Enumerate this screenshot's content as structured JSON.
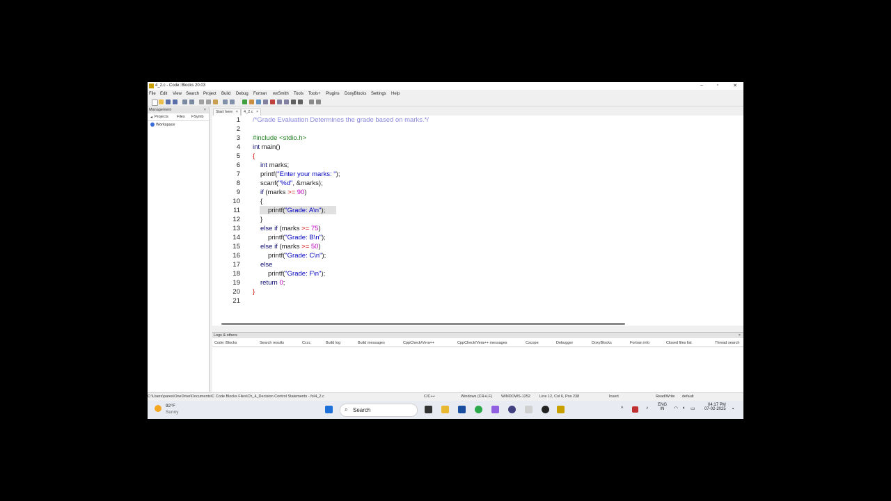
{
  "window": {
    "title": "4_2.c - Code::Blocks 20.03",
    "controls": [
      "–",
      "▫",
      "✕"
    ]
  },
  "menu": [
    "File",
    "Edit",
    "View",
    "Search",
    "Project",
    "Build",
    "Debug",
    "Fortran",
    "wxSmith",
    "Tools",
    "Tools+",
    "Plugins",
    "DoxyBlocks",
    "Settings",
    "Help"
  ],
  "management": {
    "title": "Management",
    "close": "×",
    "tabs": [
      "Projects",
      "Files",
      "FSymb"
    ],
    "workspace": "Workspace"
  },
  "editor_tabs": [
    {
      "label": "Start here",
      "close": "×"
    },
    {
      "label": "4_2.c",
      "close": "×"
    }
  ],
  "code": {
    "line_numbers": [
      "1",
      "2",
      "3",
      "4",
      "5",
      "6",
      "7",
      "8",
      "9",
      "10",
      "11",
      "12",
      "13",
      "14",
      "15",
      "16",
      "17",
      "18",
      "19",
      "20",
      "21"
    ],
    "l1": "/*Grade Evaluation Determines the grade based on marks.*/",
    "l3": "#include <stdio.h>",
    "l4a": "int",
    "l4b": " main()",
    "l5": "{",
    "l6a": "int",
    "l6b": " marks;",
    "l7a": "printf(",
    "l7b": "\"Enter your marks: \"",
    "l7c": ");",
    "l8a": "scanf(",
    "l8b": "\"%d\"",
    "l8c": ", &marks);",
    "l9a": "if",
    "l9b": " (marks ",
    "l9c": ">=",
    "l9d": " 90",
    "l9e": ")",
    "l10": "{",
    "l11a": "printf(",
    "l11b": "\"Grade: A\\n\"",
    "l11c": ");",
    "l12": "}",
    "l13a": "else if",
    "l13b": " (marks ",
    "l13c": ">=",
    "l13d": " 75",
    "l13e": ")",
    "l14a": "printf(",
    "l14b": "\"Grade: B\\n\"",
    "l14c": ");",
    "l15a": "else if",
    "l15b": " (marks ",
    "l15c": ">=",
    "l15d": " 50",
    "l15e": ")",
    "l16a": "printf(",
    "l16b": "\"Grade: C\\n\"",
    "l16c": ");",
    "l17": "else",
    "l18a": "printf(",
    "l18b": "\"Grade: F\\n\"",
    "l18c": ");",
    "l19a": "return",
    "l19b": " 0",
    "l19c": ";",
    "l20": "}"
  },
  "logs": {
    "title": "Logs & others",
    "close": "×",
    "tabs": [
      "Code::Blocks",
      "Search results",
      "Cccc",
      "Build log",
      "Build messages",
      "CppCheck/Vera++",
      "CppCheck/Vera++ messages",
      "Cscope",
      "Debugger",
      "DoxyBlocks",
      "Fortran info",
      "Closed files list",
      "Thread search"
    ]
  },
  "status": {
    "path": "C:\\Users\\pares\\OneDrive\\Documents\\C Code Blocks Files\\Ch_4_Decision Control Statements - fo\\4_2.c",
    "language": "C/C++",
    "eol": "Windows (CR+LF)",
    "encoding": "WINDOWS-1252",
    "position": "Line 12, Col 6, Pos 238",
    "mode": "Insert",
    "access": "Read/Write",
    "profile": "default"
  },
  "taskbar": {
    "temp": "92°F",
    "weather": "Sunny",
    "search": "Search",
    "lang1": "ENG",
    "lang2": "IN",
    "time": "04:17 PM",
    "date": "07-02-2025"
  },
  "colors": {
    "keyword": "#0b0b70",
    "string": "#0000c0",
    "number": "#c000c0",
    "comment": "#8888dd",
    "preprocessor": "#208020"
  }
}
